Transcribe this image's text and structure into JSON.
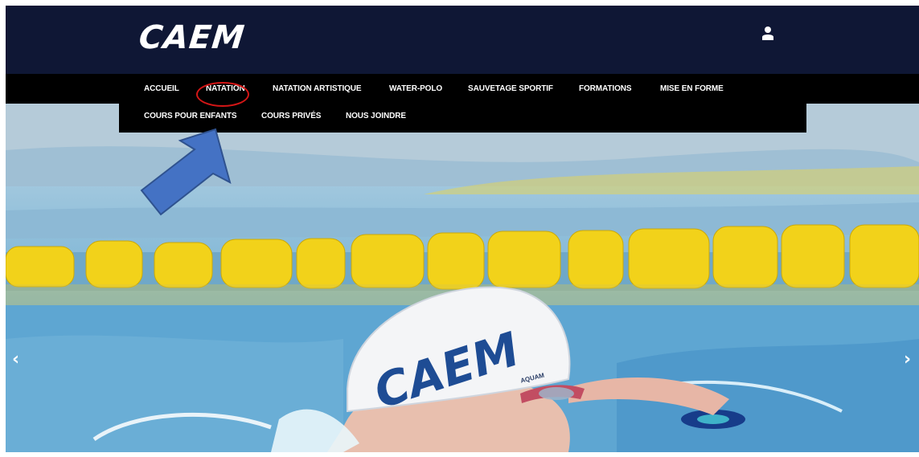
{
  "header": {
    "logo_text": "CAEM",
    "user_icon": "user-icon"
  },
  "nav": {
    "row1": [
      "ACCUEIL",
      "NATATION",
      "NATATION ARTISTIQUE",
      "WATER-POLO",
      "SAUVETAGE SPORTIF",
      "FORMATIONS",
      "MISE EN FORME"
    ],
    "row2": [
      "COURS POUR ENFANTS",
      "COURS PRIVÉS",
      "NOUS JOINDRE"
    ]
  },
  "hero": {
    "cap_text": "CAEM",
    "cap_brand": "AQUAM"
  },
  "carousel": {
    "prev_icon": "chevron-left-icon",
    "next_icon": "chevron-right-icon",
    "prev_glyph": "‹",
    "next_glyph": "›"
  },
  "annotations": {
    "highlight_color": "#d41616",
    "arrow_color": "#4472c4",
    "arrow_icon": "pointer-arrow-icon"
  },
  "colors": {
    "header_bg": "#0f1735",
    "menu_bg": "#000000",
    "lane_rope": "#f2d21a"
  }
}
